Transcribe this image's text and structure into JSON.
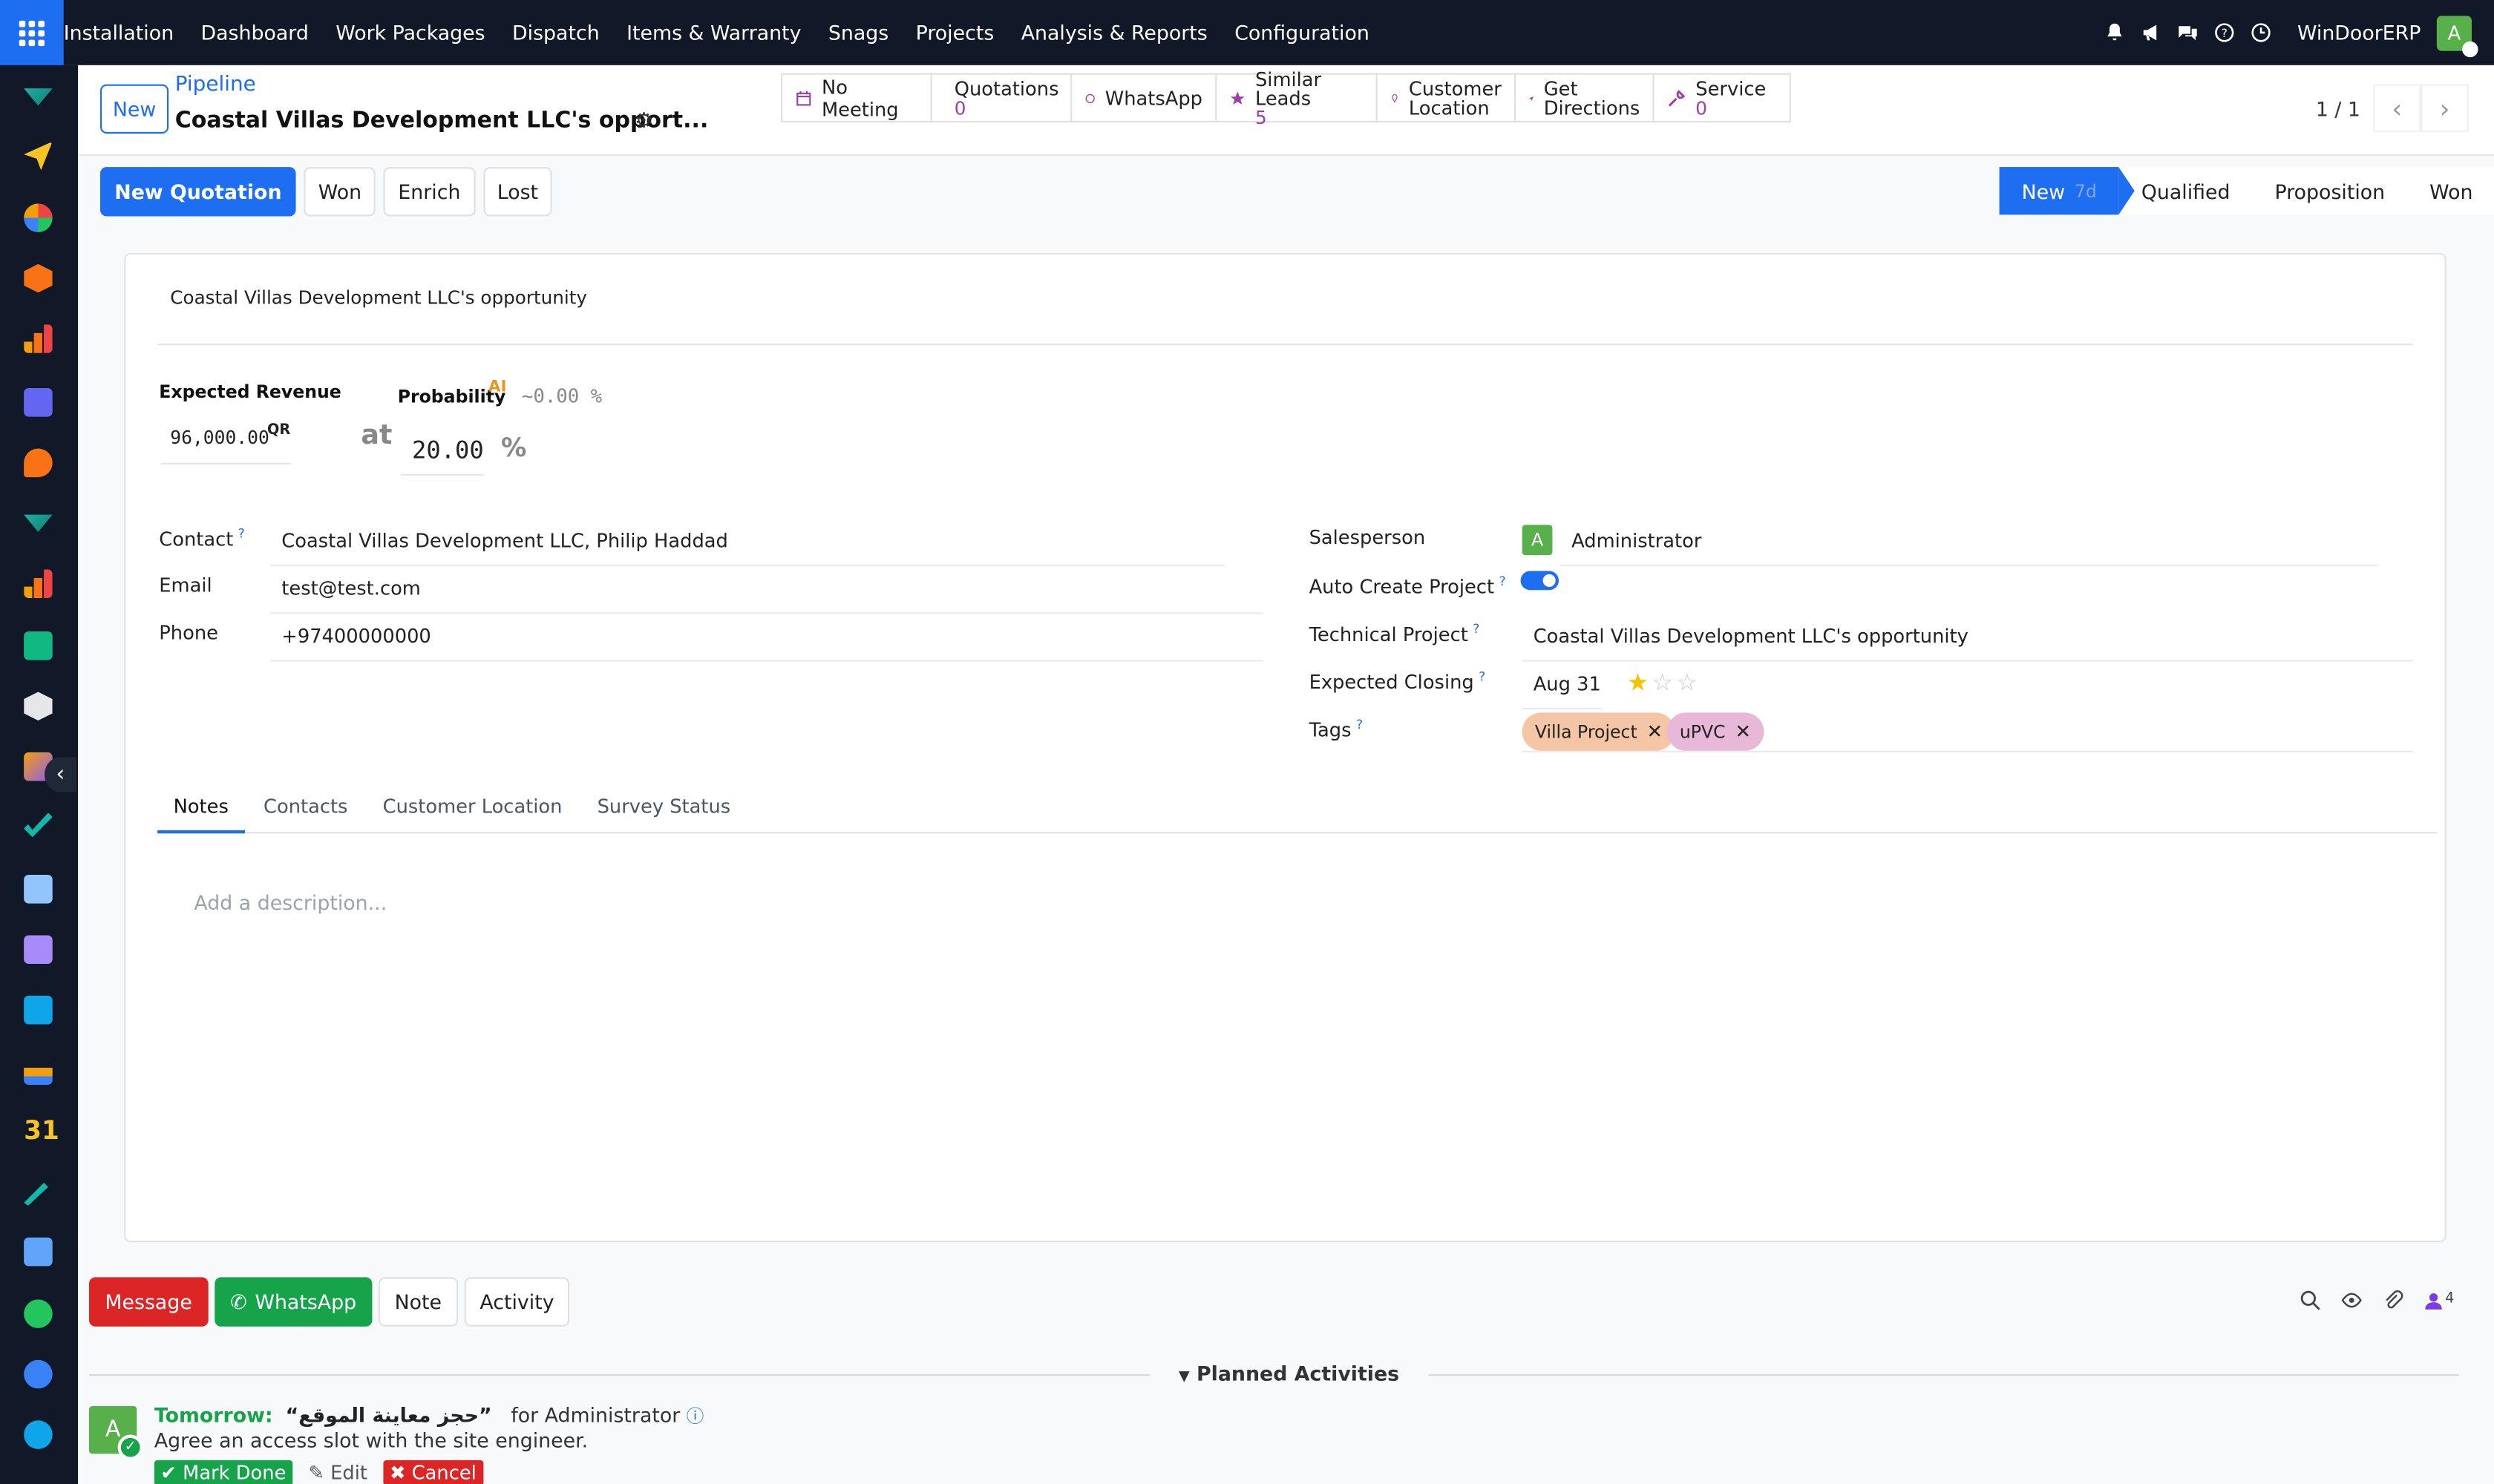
{
  "navbar": {
    "menu": [
      "Installation",
      "Dashboard",
      "Work Packages",
      "Dispatch",
      "Items & Warranty",
      "Snags",
      "Projects",
      "Analysis & Reports",
      "Configuration"
    ],
    "company": "WinDoorERP",
    "avatar_letter": "A"
  },
  "breadcrumb": {
    "new_label": "New",
    "parent": "Pipeline",
    "title": "Coastal Villas Development LLC's opport..."
  },
  "smart_buttons": {
    "no_meeting": "No Meeting",
    "quotations": "Quotations",
    "quotations_count": "0",
    "whatsapp": "WhatsApp",
    "similar_leads": "Similar Leads",
    "similar_leads_count": "5",
    "customer_location_1": "Customer",
    "customer_location_2": "Location",
    "get_directions_1": "Get",
    "get_directions_2": "Directions",
    "service": "Service",
    "service_count": "0"
  },
  "pager": {
    "value": "1 / 1"
  },
  "actions": {
    "new_quotation": "New Quotation",
    "won": "Won",
    "enrich": "Enrich",
    "lost": "Lost"
  },
  "stages": {
    "current": "New",
    "current_days": "7d",
    "others": [
      "Qualified",
      "Proposition",
      "Won"
    ]
  },
  "form": {
    "opportunity_name": "Coastal Villas Development LLC's opportunity",
    "expected_revenue_label": "Expected Revenue",
    "expected_revenue": "96,000.00",
    "currency": "QR",
    "at_label": "at",
    "probability_label": "Probability",
    "ai_badge": "AI",
    "ai_probability": "~0.00 %",
    "probability": "20.00",
    "percent_sign": "%",
    "contact_label": "Contact",
    "contact": "Coastal Villas Development LLC, Philip Haddad",
    "email_label": "Email",
    "email": "test@test.com",
    "phone_label": "Phone",
    "phone": "+97400000000",
    "salesperson_label": "Salesperson",
    "salesperson": "Administrator",
    "salesperson_initial": "A",
    "auto_create_project_label": "Auto Create Project",
    "auto_create_project": true,
    "technical_project_label": "Technical Project",
    "technical_project": "Coastal Villas Development LLC's opportunity",
    "expected_closing_label": "Expected Closing",
    "expected_closing": "Aug 31",
    "priority_stars": 1,
    "tags_label": "Tags",
    "tags": [
      {
        "label": "Villa Project",
        "color": "#f5c6a5"
      },
      {
        "label": "uPVC",
        "color": "#e8b8d8"
      }
    ],
    "help_mark": "?"
  },
  "tabs": [
    "Notes",
    "Contacts",
    "Customer Location",
    "Survey Status"
  ],
  "notes": {
    "placeholder": "Add a description..."
  },
  "chatter": {
    "message": "Message",
    "whatsapp": "WhatsApp",
    "note": "Note",
    "activity": "Activity",
    "followers_count": "4",
    "planned_activities": "Planned Activities"
  },
  "activity": {
    "when": "Tomorrow:",
    "summary": "“حجز معاينة الموقع”",
    "for": "for Administrator",
    "avatar_letter": "A",
    "note": "Agree an access slot with the site engineer.",
    "mark_done": "Mark Done",
    "edit": "Edit",
    "cancel": "Cancel"
  },
  "colors": {
    "primary": "#1d6ef0",
    "navbar": "#111827",
    "message_button": "#dc2626",
    "whatsapp_button": "#16a34a"
  }
}
